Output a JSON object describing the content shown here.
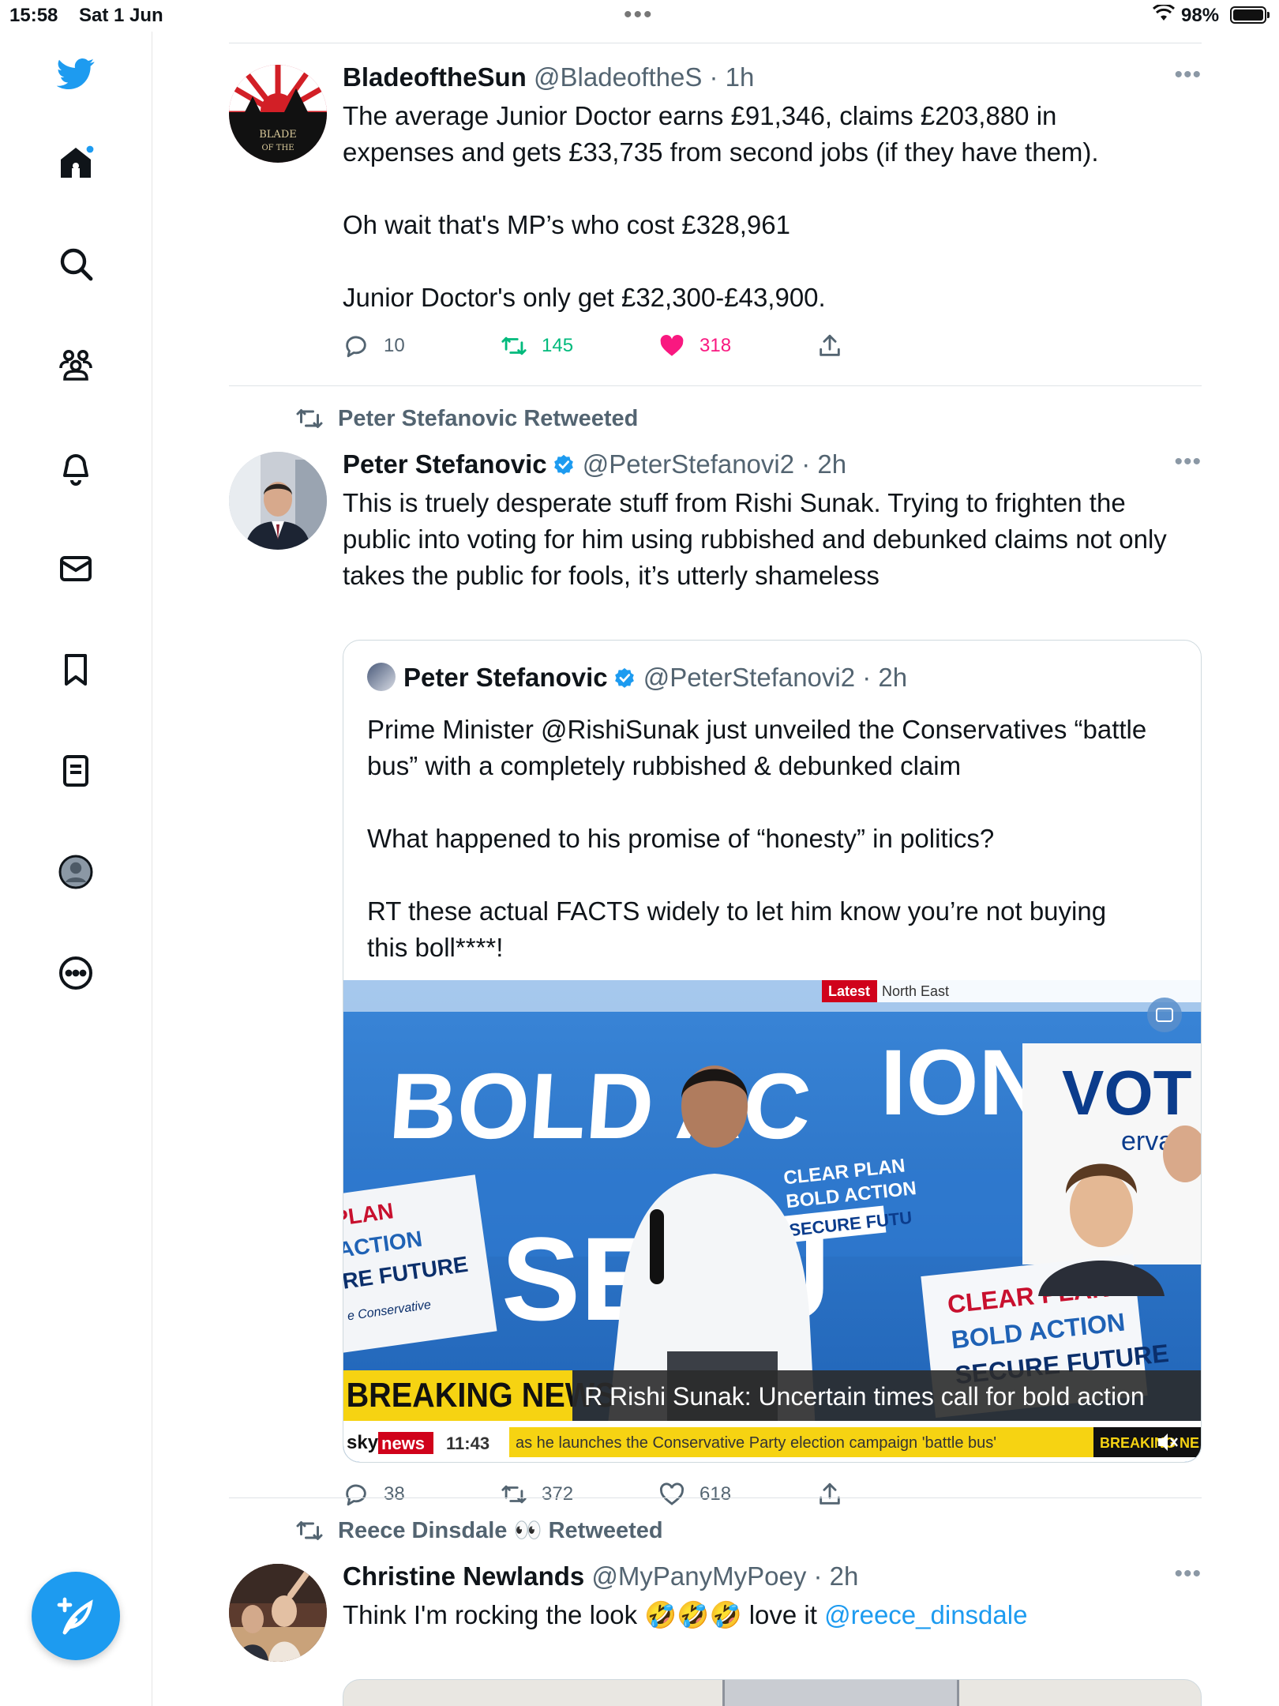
{
  "status_bar": {
    "time": "15:58",
    "date": "Sat 1 Jun",
    "battery": "98%"
  },
  "sidebar": {
    "items": [
      "twitter-logo",
      "home",
      "search",
      "communities",
      "notifications",
      "messages",
      "bookmarks",
      "lists",
      "profile",
      "more"
    ],
    "compose_label": "Compose tweet"
  },
  "tweets": [
    {
      "name": "BladeoftheSun",
      "handle": "@BladeoftheS · 1h",
      "avatar_text": [
        "BLADE",
        "OF THE"
      ],
      "lines": [
        "The average Junior Doctor earns £91,346, claims £203,880 in",
        "expenses and gets £33,735 from second jobs (if they have them).",
        "",
        "Oh wait that's MP’s who cost £328,961",
        "",
        "Junior Doctor's only get £32,300-£43,900."
      ],
      "replies": "10",
      "retweets": "145",
      "likes": "318"
    },
    {
      "retweeted_by": "Peter Stefanovic Retweeted",
      "name": "Peter Stefanovic",
      "handle": "@PeterStefanovi2 · 2h",
      "lines": [
        "This is truely desperate stuff from Rishi Sunak. Trying to frighten the",
        "public into voting for him using rubbished and debunked claims not only",
        "takes the public for fools, it’s utterly shameless"
      ],
      "quote": {
        "name": "Peter Stefanovic",
        "handle": "@PeterStefanovi2 · 2h",
        "lines": [
          "Prime Minister @RishiSunak just unveiled the Conservatives “battle",
          "bus” with a completely rubbished & debunked claim",
          "",
          "What happened to his promise of “honesty” in politics?",
          "",
          "RT these actual FACTS widely to let him know you’re not buying",
          "this boll****!"
        ],
        "media": {
          "bus_text_1": "BOLD AC",
          "bus_text_1b": "ION",
          "bus_text_2": "SECU",
          "sign_left": [
            "PLAN",
            "ACTION",
            "RE FUTURE",
            "e Conservative"
          ],
          "sign_right": [
            "CLEAR PLAN",
            "BOLD ACTION",
            "SECURE FUTURE"
          ],
          "sign_mid": [
            "CLEAR PLAN",
            "BOLD ACTION",
            "SECURE FUTU"
          ],
          "vote_text": "VOT",
          "vote_sub": "erva",
          "latest_tag": "Latest",
          "region_tag": "North East",
          "breaking_label": "BREAKING NEWS",
          "headline": "R Rishi Sunak: Uncertain times call for bold action",
          "channel_sky": "sky",
          "channel_news": "news",
          "clock": "11:43",
          "ticker": "as he launches the Conservative Party election campaign 'battle bus'",
          "ticker_right": "BREAKING NE"
        }
      },
      "replies": "38",
      "retweets": "372",
      "likes": "618"
    },
    {
      "retweeted_by": "Reece Dinsdale 👀 Retweeted",
      "name": "Christine Newlands",
      "handle": "@MyPanyMyPoey · 2h",
      "text_before": "Think I'm rocking the look 🤣🤣🤣 love it ",
      "mention": "@reece_dinsdale"
    }
  ],
  "colors": {
    "accent": "#1d9bf0",
    "like_pink": "#f91880",
    "retweet_green": "#00ba7c",
    "muted": "#536471"
  }
}
